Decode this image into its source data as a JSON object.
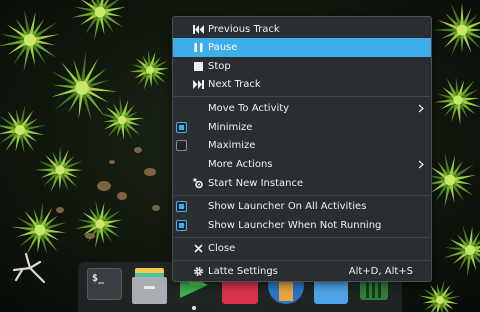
{
  "colors": {
    "menu_background": "#2a2e32",
    "highlight": "#3daee9",
    "menu_text": "#eff0f1",
    "separator": "#41464b"
  },
  "menu": {
    "media_items": [
      {
        "label": "Previous Track",
        "icon": "skip-previous-icon"
      },
      {
        "label": "Pause",
        "icon": "pause-icon",
        "highlighted": true
      },
      {
        "label": "Stop",
        "icon": "stop-icon"
      },
      {
        "label": "Next Track",
        "icon": "skip-next-icon"
      }
    ],
    "window_items": [
      {
        "label": "Move To Activity",
        "submenu": true
      },
      {
        "label": "Minimize",
        "checkbox": true,
        "checked": true
      },
      {
        "label": "Maximize",
        "checkbox": true,
        "checked": false
      },
      {
        "label": "More Actions",
        "submenu": true
      },
      {
        "label": "Start New Instance",
        "icon": "new-instance-icon"
      }
    ],
    "launcher_items": [
      {
        "label": "Show Launcher On All Activities",
        "checkbox": true,
        "checked": true
      },
      {
        "label": "Show Launcher When Not Running",
        "checkbox": true,
        "checked": true
      }
    ],
    "close_item": {
      "label": "Close",
      "icon": "close-icon"
    },
    "settings_item": {
      "label": "Latte Settings",
      "icon": "gear-icon",
      "shortcut": "Alt+D, Alt+S"
    }
  },
  "dock": {
    "terminal_prompt": "$_",
    "apps": [
      {
        "name": "terminal",
        "icon": "terminal-icon"
      },
      {
        "name": "files",
        "icon": "file-manager-icon"
      },
      {
        "name": "play",
        "icon": "media-player-icon",
        "active": true
      },
      {
        "name": "mixer",
        "icon": "audio-mixer-icon"
      },
      {
        "name": "disk",
        "icon": "disk-app-icon"
      },
      {
        "name": "folder",
        "icon": "folder-icon"
      },
      {
        "name": "monitor",
        "icon": "system-monitor-icon"
      }
    ]
  }
}
